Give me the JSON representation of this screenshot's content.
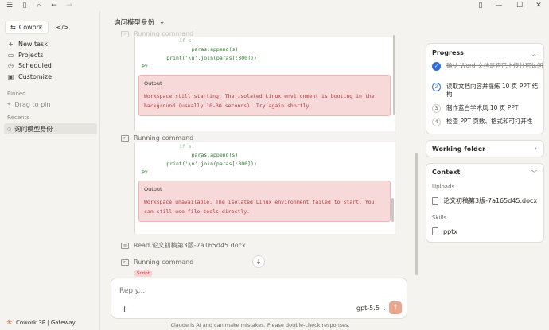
{
  "topbar": {
    "icons": [
      "menu-icon",
      "sidebar-toggle-icon",
      "search-icon",
      "back-icon",
      "forward-icon"
    ],
    "window_controls": [
      "layout-icon",
      "minimize-icon",
      "maximize-icon",
      "close-icon"
    ]
  },
  "sidebar": {
    "tabs": [
      {
        "label": "Cowork",
        "icon": "cowork-icon",
        "active": true
      },
      {
        "label": "",
        "icon": "code-icon",
        "active": false
      }
    ],
    "nav": [
      {
        "label": "New task",
        "icon": "plus-icon"
      },
      {
        "label": "Projects",
        "icon": "folder-icon"
      },
      {
        "label": "Scheduled",
        "icon": "clock-icon"
      },
      {
        "label": "Customize",
        "icon": "customize-icon"
      }
    ],
    "pinned_heading": "Pinned",
    "pinned_placeholder": "Drag to pin",
    "recents_heading": "Recents",
    "recents": [
      {
        "label": "询问模型身份"
      }
    ],
    "footer": "Cowork 3P | Gateway"
  },
  "main": {
    "title": "询问模型身份",
    "faded_step": "Running command",
    "block1": {
      "code_lines": [
        "            if s:",
        "                paras.append(s)",
        "        print('\\n'.join(paras[:300]))",
        "PY"
      ],
      "output_label": "Output",
      "output_text": "Workspace still starting. The isolated Linux environment is booting in the background (usually 10-30 seconds). Try again shortly."
    },
    "step2": "Running command",
    "block2": {
      "code_lines": [
        "            if s:",
        "                paras.append(s)",
        "        print('\\n'.join(paras[:300]))",
        "PY"
      ],
      "output_label": "Output",
      "output_text": "Workspace unavailable. The isolated Linux environment failed to start. You can still use file tools directly."
    },
    "step3": "Read 论文初稿第3版-7a165d45.docx",
    "step4": "Running command",
    "script_badge": "Script",
    "input_placeholder": "Reply...",
    "model": "gpt-5.5",
    "disclaimer": "Claude is AI and can make mistakes. Please double-check responses."
  },
  "right": {
    "progress_title": "Progress",
    "progress": [
      {
        "num": "✓",
        "text": "确认 Word 文档是否已上传并可访问",
        "state": "done"
      },
      {
        "num": "2",
        "text": "读取文档内容并提炼 10 页 PPT 结构",
        "state": "current"
      },
      {
        "num": "3",
        "text": "制作蓝白学术风 10 页 PPT",
        "state": "todo"
      },
      {
        "num": "4",
        "text": "检查 PPT 页数、格式和可打开性",
        "state": "todo"
      }
    ],
    "working_folder_title": "Working folder",
    "context_title": "Context",
    "uploads_label": "Uploads",
    "upload_file": "论文初稿第3版-7a165d45.docx",
    "skills_label": "Skills",
    "skill": "pptx"
  }
}
